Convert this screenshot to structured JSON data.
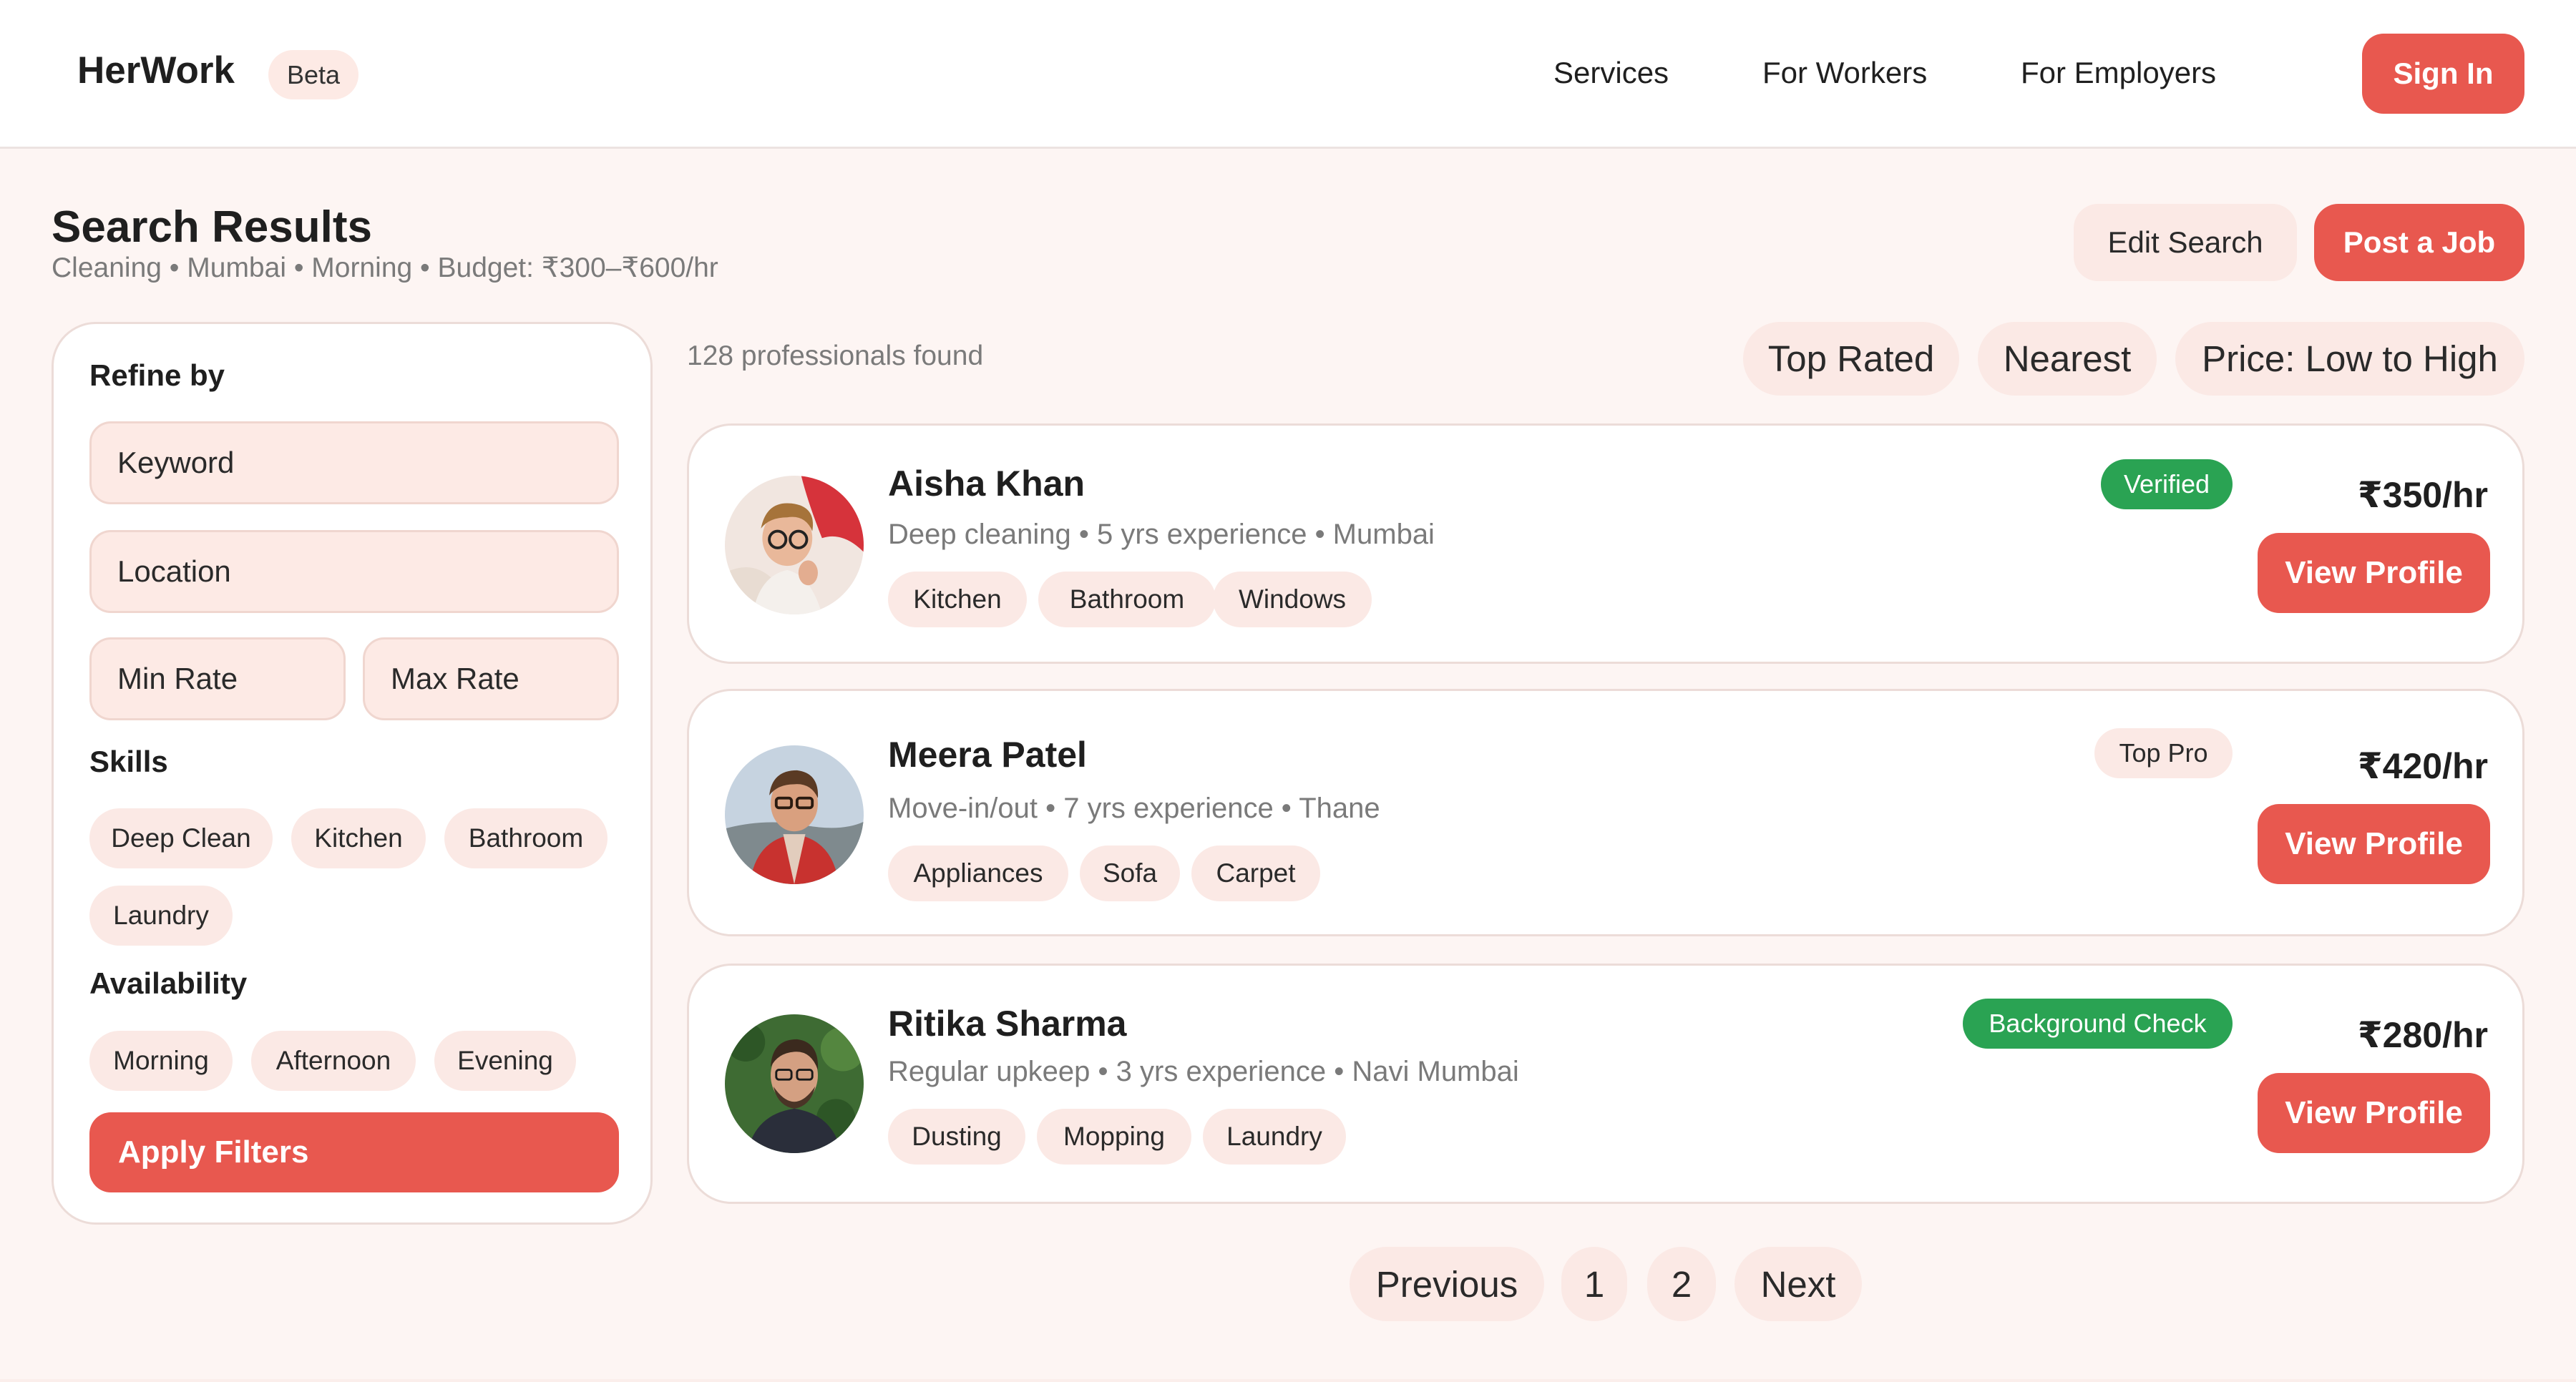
{
  "nav": {
    "brand": "HerWork",
    "beta": "Beta",
    "links": [
      "Services",
      "For Workers",
      "For Employers"
    ],
    "sign_in": "Sign In"
  },
  "header": {
    "title": "Search Results",
    "subtitle": "Cleaning • Mumbai • Morning • Budget: ₹300–₹600/hr",
    "edit_search": "Edit Search",
    "post_job": "Post a Job"
  },
  "sidebar": {
    "heading": "Refine by",
    "keyword_placeholder": "Keyword",
    "location_placeholder": "Location",
    "min_rate_placeholder": "Min Rate",
    "max_rate_placeholder": "Max Rate",
    "skills_heading": "Skills",
    "skills": [
      "Deep Clean",
      "Kitchen",
      "Bathroom",
      "Laundry"
    ],
    "availability_heading": "Availability",
    "availability": [
      "Morning",
      "Afternoon",
      "Evening"
    ],
    "apply": "Apply Filters"
  },
  "results": {
    "count_text": "128 professionals found",
    "sort_options": [
      "Top Rated",
      "Nearest",
      "Price: Low to High"
    ],
    "cards": [
      {
        "name": "Aisha Khan",
        "meta": "Deep cleaning • 5 yrs experience • Mumbai",
        "tags": [
          "Kitchen",
          "Bathroom",
          "Windows"
        ],
        "badge": "Verified",
        "badge_style": "green",
        "price": "₹350/hr",
        "cta": "View Profile"
      },
      {
        "name": "Meera Patel",
        "meta": "Move-in/out • 7 yrs experience • Thane",
        "tags": [
          "Appliances",
          "Sofa",
          "Carpet"
        ],
        "badge": "Top Pro",
        "badge_style": "soft",
        "price": "₹420/hr",
        "cta": "View Profile"
      },
      {
        "name": "Ritika Sharma",
        "meta": "Regular upkeep • 3 yrs experience • Navi Mumbai",
        "tags": [
          "Dusting",
          "Mopping",
          "Laundry"
        ],
        "badge": "Background Check",
        "badge_style": "green",
        "price": "₹280/hr",
        "cta": "View Profile"
      }
    ]
  },
  "pagination": {
    "previous": "Previous",
    "pages": [
      "1",
      "2"
    ],
    "next": "Next"
  },
  "colors": {
    "accent": "#e8584f",
    "page_bg": "#fdf5f3",
    "chip_bg": "#fbe9e5",
    "verified_green": "#2aa353"
  }
}
